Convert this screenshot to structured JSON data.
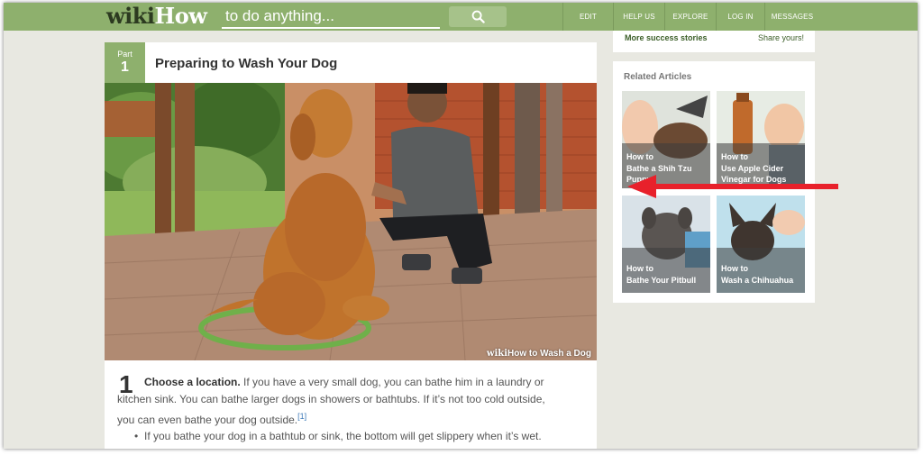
{
  "header": {
    "logo_wiki": "wiki",
    "logo_how": "How",
    "search_placeholder": "to do anything...",
    "nav": [
      {
        "label": "EDIT"
      },
      {
        "label": "HELP US"
      },
      {
        "label": "EXPLORE"
      },
      {
        "label": "LOG IN"
      },
      {
        "label": "MESSAGES"
      }
    ]
  },
  "article": {
    "part_label": "Part",
    "part_number": "1",
    "title": "Preparing to Wash Your Dog",
    "image_caption_wiki": "wiki",
    "image_caption_rest": "How to Wash a Dog",
    "step_number": "1",
    "step_bold": "Choose a location.",
    "step_text": " If you have a very small dog, you can bathe him in a laundry or kitchen sink. You can bathe larger dogs in showers or bathtubs. If it’s not too cold outside, you can even bathe your dog outside.",
    "step_ref": "[1]",
    "bullet": "If you bathe your dog in a bathtub or sink, the bottom will get slippery when it’s wet."
  },
  "sidebar": {
    "more_success": "More success stories",
    "share": "Share yours!",
    "related_title": "Related Articles",
    "related": [
      {
        "how": "How to",
        "title": "Bathe a Shih Tzu Puppy"
      },
      {
        "how": "How to",
        "title": "Use Apple Cider Vinegar for Dogs"
      },
      {
        "how": "How to",
        "title": "Bathe Your Pitbull"
      },
      {
        "how": "How to",
        "title": "Wash a Chihuahua"
      }
    ]
  },
  "colors": {
    "brand_green": "#8eb06d",
    "annotation_arrow": "#e8212b"
  }
}
